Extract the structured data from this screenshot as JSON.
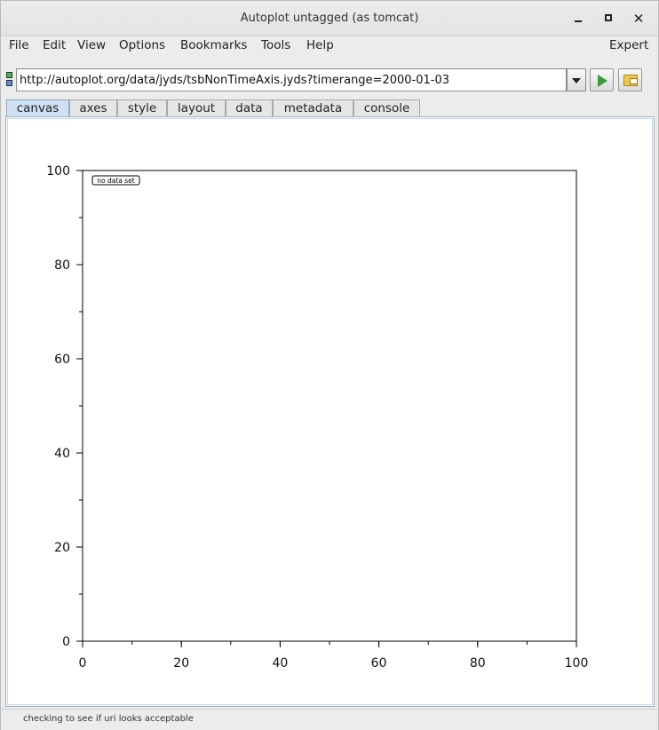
{
  "window": {
    "title": "Autoplot untagged (as tomcat)",
    "minimize_label": "",
    "maximize_label": "",
    "close_label": "✕"
  },
  "menubar": {
    "items": [
      "File",
      "Edit",
      "View",
      "Options",
      "Bookmarks",
      "Tools",
      "Help"
    ],
    "expert_label": "Expert"
  },
  "url_bar": {
    "value": "http://autoplot.org/data/jyds/tsbNonTimeAxis.jyds?timerange=2000-01-03",
    "status_colors": {
      "top": "#4cb04c",
      "bottom": "#5b8dd9"
    },
    "go_icon": "play-icon",
    "open_icon": "folder-icon"
  },
  "tabs": {
    "items": [
      "canvas",
      "axes",
      "style",
      "layout",
      "data",
      "metadata",
      "console"
    ],
    "active": "canvas"
  },
  "plot": {
    "message": "no data set"
  },
  "chart_data": {
    "type": "line",
    "series": [],
    "x_ticks": [
      "0",
      "20",
      "40",
      "60",
      "80",
      "100"
    ],
    "y_ticks": [
      "0",
      "20",
      "40",
      "60",
      "80",
      "100"
    ],
    "xlim": [
      0,
      100
    ],
    "ylim": [
      0,
      100
    ],
    "minor_tick_step": 10,
    "grid": false,
    "title": "",
    "xlabel": "",
    "ylabel": ""
  },
  "statusbar": {
    "text": "checking to see if uri looks acceptable"
  }
}
